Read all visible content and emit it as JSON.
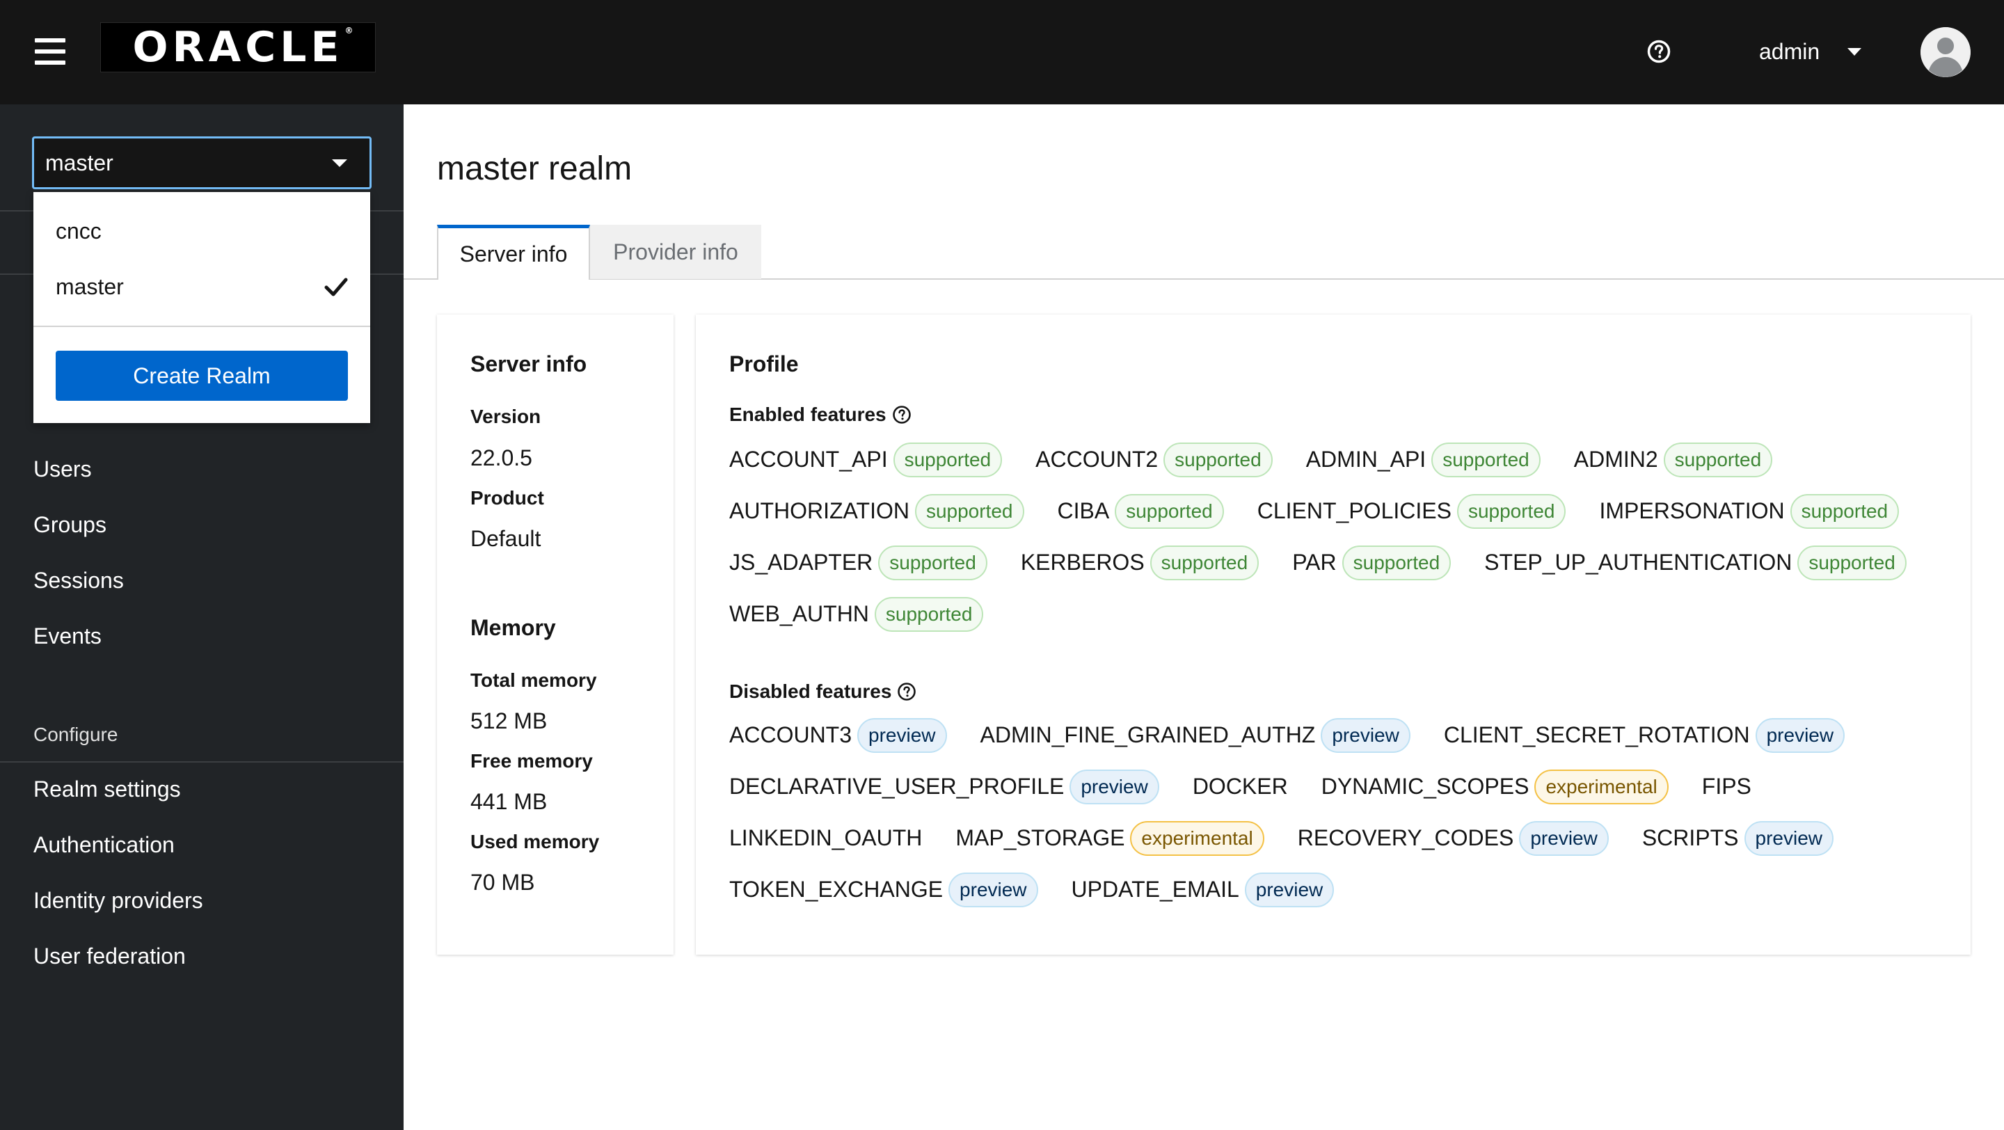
{
  "header": {
    "logo_text": "ORACLE",
    "logo_mark": "®",
    "username": "admin",
    "icons": {
      "menu": "hamburger-icon",
      "help": "help-circle-icon",
      "user_caret": "caret-down-icon",
      "avatar": "avatar-icon"
    }
  },
  "realm_selector": {
    "selected": "master",
    "options": [
      {
        "label": "cncc",
        "checked": false
      },
      {
        "label": "master",
        "checked": true
      }
    ],
    "create_label": "Create Realm"
  },
  "sidebar": {
    "manage_items": [
      "Users",
      "Groups",
      "Sessions",
      "Events"
    ],
    "configure_heading": "Configure",
    "configure_items": [
      "Realm settings",
      "Authentication",
      "Identity providers",
      "User federation"
    ]
  },
  "main": {
    "title": "master realm",
    "tabs": [
      {
        "label": "Server info",
        "active": true
      },
      {
        "label": "Provider info",
        "active": false
      }
    ],
    "server_info": {
      "heading": "Server info",
      "version_label": "Version",
      "version": "22.0.5",
      "product_label": "Product",
      "product": "Default",
      "memory_heading": "Memory",
      "total_label": "Total memory",
      "total": "512 MB",
      "free_label": "Free memory",
      "free": "441 MB",
      "used_label": "Used memory",
      "used": "70 MB"
    },
    "profile": {
      "heading": "Profile",
      "enabled_heading": "Enabled features",
      "enabled_rows": [
        [
          {
            "name": "ACCOUNT_API",
            "badge": "supported"
          },
          {
            "name": "ACCOUNT2",
            "badge": "supported"
          },
          {
            "name": "ADMIN_API",
            "badge": "supported"
          },
          {
            "name": "ADMIN2",
            "badge": "supported"
          }
        ],
        [
          {
            "name": "AUTHORIZATION",
            "badge": "supported"
          },
          {
            "name": "CIBA",
            "badge": "supported"
          },
          {
            "name": "CLIENT_POLICIES",
            "badge": "supported"
          },
          {
            "name": "IMPERSONATION",
            "badge": "supported"
          }
        ],
        [
          {
            "name": "JS_ADAPTER",
            "badge": "supported"
          },
          {
            "name": "KERBEROS",
            "badge": "supported"
          },
          {
            "name": "PAR",
            "badge": "supported"
          },
          {
            "name": "STEP_UP_AUTHENTICATION",
            "badge": "supported"
          }
        ],
        [
          {
            "name": "WEB_AUTHN",
            "badge": "supported"
          }
        ]
      ],
      "disabled_heading": "Disabled features",
      "disabled_rows": [
        [
          {
            "name": "ACCOUNT3",
            "badge": "preview"
          },
          {
            "name": "ADMIN_FINE_GRAINED_AUTHZ",
            "badge": "preview"
          },
          {
            "name": "CLIENT_SECRET_ROTATION",
            "badge": "preview"
          }
        ],
        [
          {
            "name": "DECLARATIVE_USER_PROFILE",
            "badge": "preview"
          },
          {
            "name": "DOCKER",
            "badge": ""
          },
          {
            "name": "DYNAMIC_SCOPES",
            "badge": "experimental"
          },
          {
            "name": "FIPS",
            "badge": ""
          }
        ],
        [
          {
            "name": "LINKEDIN_OAUTH",
            "badge": ""
          },
          {
            "name": "MAP_STORAGE",
            "badge": "experimental"
          },
          {
            "name": "RECOVERY_CODES",
            "badge": "preview"
          },
          {
            "name": "SCRIPTS",
            "badge": "preview"
          }
        ],
        [
          {
            "name": "TOKEN_EXCHANGE",
            "badge": "preview"
          },
          {
            "name": "UPDATE_EMAIL",
            "badge": "preview"
          }
        ]
      ]
    }
  },
  "colors": {
    "header_bg": "#151515",
    "sidebar_bg": "#212427",
    "accent": "#0066cc",
    "supported_text": "#3e8635",
    "preview_text": "#002952",
    "experimental_text": "#795600"
  }
}
